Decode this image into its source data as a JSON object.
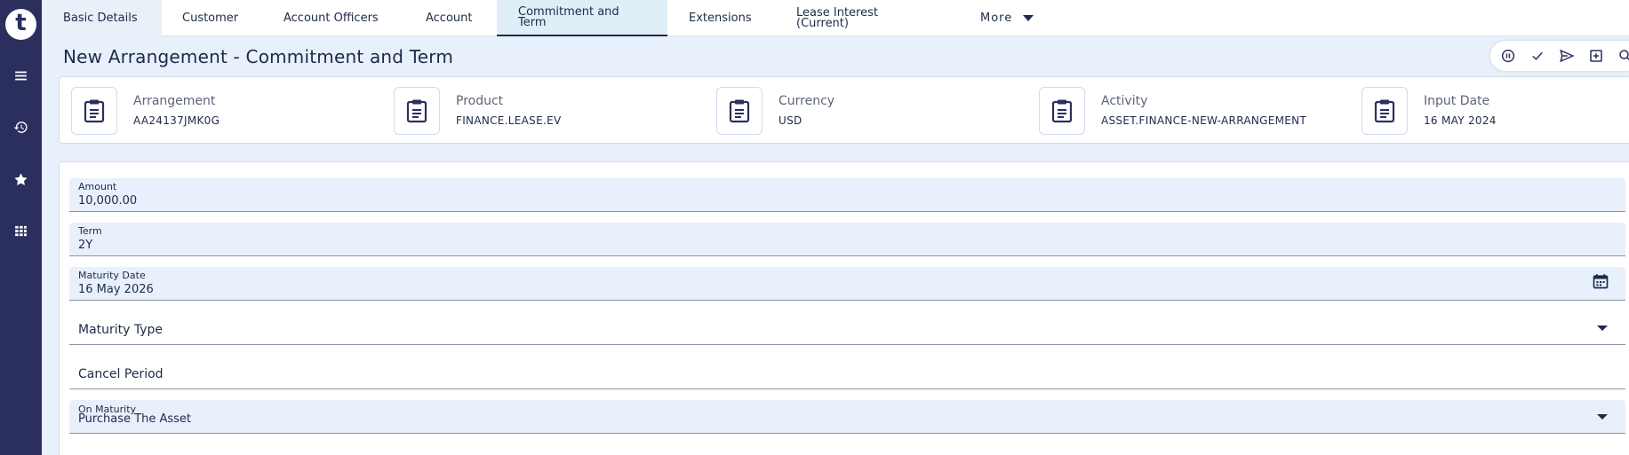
{
  "sidebar": {
    "logo": "t",
    "icons": [
      "menu-icon",
      "history-icon",
      "star-icon",
      "grid-icon"
    ]
  },
  "tabs": [
    {
      "label": "Basic Details"
    },
    {
      "label": "Customer"
    },
    {
      "label": "Account Officers"
    },
    {
      "label": "Account"
    },
    {
      "label_line1": "Commitment and",
      "label_line2": "Term"
    },
    {
      "label": "Extensions"
    },
    {
      "label_line1": "Lease Interest",
      "label_line2": "(Current)"
    },
    {
      "label": "More"
    }
  ],
  "page": {
    "title": "New Arrangement - Commitment and Term"
  },
  "actions": [
    "pause-icon",
    "check-icon",
    "send-icon",
    "add-box-icon",
    "search-icon"
  ],
  "info": [
    {
      "label": "Arrangement",
      "value": "AA24137JMK0G"
    },
    {
      "label": "Product",
      "value": "FINANCE.LEASE.EV"
    },
    {
      "label": "Currency",
      "value": "USD"
    },
    {
      "label": "Activity",
      "value": "ASSET.FINANCE-NEW-ARRANGEMENT"
    },
    {
      "label": "Input Date",
      "value": "16 MAY 2024"
    }
  ],
  "form": {
    "amount": {
      "label": "Amount",
      "value": "10,000.00"
    },
    "term": {
      "label": "Term",
      "value": "2Y"
    },
    "maturity_date": {
      "label": "Maturity Date",
      "value": "16 May 2026"
    },
    "maturity_type": {
      "label": "Maturity Type"
    },
    "cancel_period": {
      "label": "Cancel Period"
    },
    "on_maturity": {
      "label": "On Maturity",
      "value": "Purchase The Asset"
    }
  },
  "colors": {
    "sidebar": "#2b2f5e",
    "background": "#e8f0fb",
    "active_tab": "#e0eef8",
    "text": "#1e2a4a"
  }
}
